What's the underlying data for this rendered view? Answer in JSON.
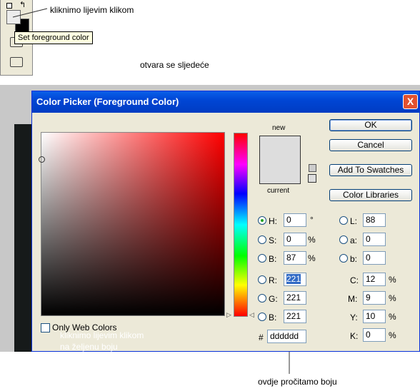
{
  "toolbar": {
    "tooltip": "Set foreground color"
  },
  "annotations": {
    "click_fg": "kliknimo lijevim klikom",
    "opens": "otvara se sljedeće",
    "click_field_line1": "kliknimo lijevim klikom",
    "click_field_line2": "na željenu boju",
    "read_color": "ovdje pročitamo boju"
  },
  "dialog": {
    "title": "Color Picker (Foreground Color)",
    "close": "X",
    "new_label": "new",
    "current_label": "current",
    "only_web_colors": "Only Web Colors",
    "buttons": {
      "ok": "OK",
      "cancel": "Cancel",
      "add_to_swatches": "Add To Swatches",
      "color_libraries": "Color Libraries"
    },
    "hsb": {
      "h_label": "H:",
      "h_value": "0",
      "h_unit": "°",
      "s_label": "S:",
      "s_value": "0",
      "s_unit": "%",
      "b_label": "B:",
      "b_value": "87",
      "b_unit": "%"
    },
    "rgb": {
      "r_label": "R:",
      "r_value": "221",
      "g_label": "G:",
      "g_value": "221",
      "b_label": "B:",
      "b_value": "221"
    },
    "lab": {
      "l_label": "L:",
      "l_value": "88",
      "a_label": "a:",
      "a_value": "0",
      "b_label": "b:",
      "b_value": "0"
    },
    "cmyk": {
      "c_label": "C:",
      "c_value": "12",
      "c_unit": "%",
      "m_label": "M:",
      "m_value": "9",
      "m_unit": "%",
      "y_label": "Y:",
      "y_value": "10",
      "y_unit": "%",
      "k_label": "K:",
      "k_value": "0",
      "k_unit": "%"
    },
    "hex": {
      "label": "#",
      "value": "dddddd"
    },
    "preview_color": "#dddddd"
  }
}
